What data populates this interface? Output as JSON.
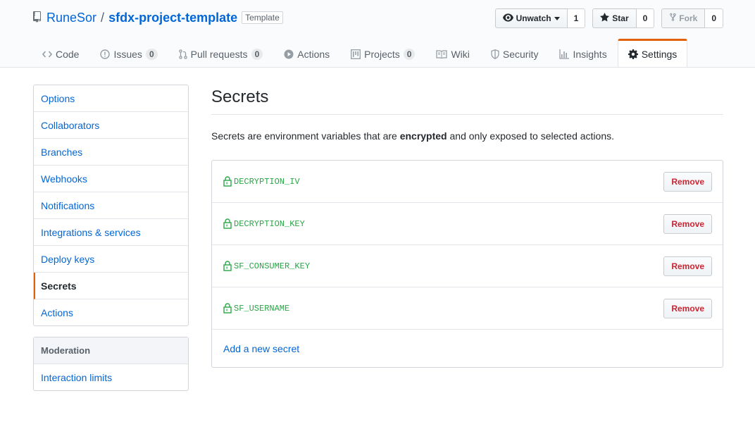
{
  "repo": {
    "owner": "RuneSor",
    "separator": "/",
    "name": "sfdx-project-template",
    "badge": "Template"
  },
  "actions": {
    "watch": {
      "label": "Unwatch",
      "count": "1",
      "icon": "eye-icon"
    },
    "star": {
      "label": "Star",
      "count": "0",
      "icon": "star-icon"
    },
    "fork": {
      "label": "Fork",
      "count": "0",
      "icon": "fork-icon"
    }
  },
  "tabs": [
    {
      "label": "Code",
      "icon": "code-icon"
    },
    {
      "label": "Issues",
      "count": "0",
      "icon": "issue-icon"
    },
    {
      "label": "Pull requests",
      "count": "0",
      "icon": "pull-request-icon"
    },
    {
      "label": "Actions",
      "icon": "play-icon"
    },
    {
      "label": "Projects",
      "count": "0",
      "icon": "project-icon"
    },
    {
      "label": "Wiki",
      "icon": "book-icon"
    },
    {
      "label": "Security",
      "icon": "shield-icon"
    },
    {
      "label": "Insights",
      "icon": "graph-icon"
    },
    {
      "label": "Settings",
      "icon": "gear-icon",
      "selected": true
    }
  ],
  "sidebar": {
    "items": [
      {
        "label": "Options"
      },
      {
        "label": "Collaborators"
      },
      {
        "label": "Branches"
      },
      {
        "label": "Webhooks"
      },
      {
        "label": "Notifications"
      },
      {
        "label": "Integrations & services"
      },
      {
        "label": "Deploy keys"
      },
      {
        "label": "Secrets",
        "selected": true
      },
      {
        "label": "Actions"
      }
    ],
    "moderation": {
      "heading": "Moderation",
      "items": [
        {
          "label": "Interaction limits"
        }
      ]
    }
  },
  "main": {
    "title": "Secrets",
    "description_pre": "Secrets are environment variables that are ",
    "description_bold": "encrypted",
    "description_post": " and only exposed to selected actions.",
    "secrets": [
      {
        "name": "DECRYPTION_IV",
        "action": "Remove"
      },
      {
        "name": "DECRYPTION_KEY",
        "action": "Remove"
      },
      {
        "name": "SF_CONSUMER_KEY",
        "action": "Remove"
      },
      {
        "name": "SF_USERNAME",
        "action": "Remove"
      }
    ],
    "add_label": "Add a new secret"
  },
  "colors": {
    "accent": "#e36209",
    "link": "#0366d6",
    "secret_green": "#28a745",
    "danger": "#cb2431"
  }
}
